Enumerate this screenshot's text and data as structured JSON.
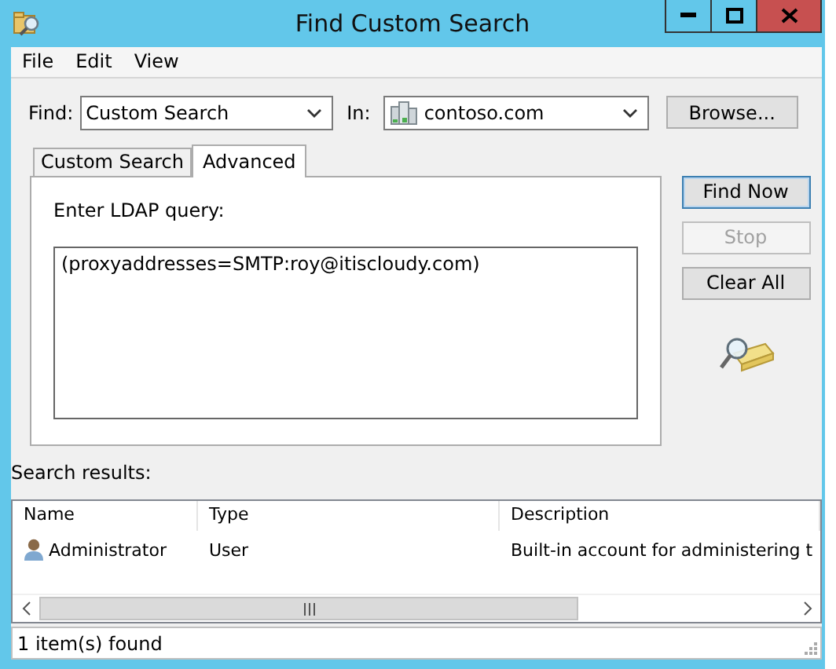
{
  "window": {
    "title": "Find Custom Search"
  },
  "menu": [
    "File",
    "Edit",
    "View"
  ],
  "find": {
    "label": "Find:",
    "value": "Custom Search"
  },
  "in": {
    "label": "In:",
    "value": "contoso.com"
  },
  "browse_button": "Browse...",
  "tabs": [
    {
      "label": "Custom Search",
      "selected": false
    },
    {
      "label": "Advanced",
      "selected": true
    }
  ],
  "query": {
    "label": "Enter LDAP query:",
    "value": "(proxyaddresses=SMTP:roy@itiscloudy.com)"
  },
  "buttons": [
    {
      "label": "Find Now",
      "disabled": false,
      "default": true
    },
    {
      "label": "Stop",
      "disabled": true,
      "default": false
    },
    {
      "label": "Clear All",
      "disabled": false,
      "default": false
    }
  ],
  "results": {
    "label": "Search results:",
    "columns": [
      "Name",
      "Type",
      "Description"
    ],
    "rows": [
      {
        "name": "Administrator",
        "type": "User",
        "description": "Built-in account for administering t"
      }
    ]
  },
  "status_bar": "1 item(s) found"
}
